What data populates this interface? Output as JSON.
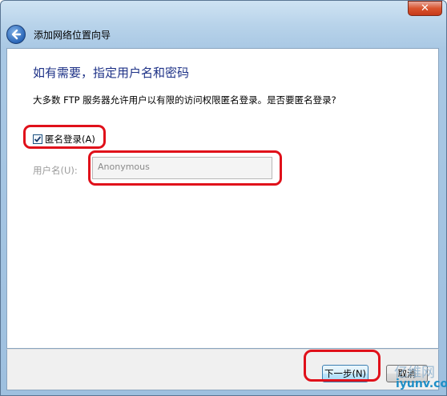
{
  "window": {
    "title": "添加网络位置向导",
    "close_glyph": "✕"
  },
  "page": {
    "heading": "如有需要，指定用户名和密码",
    "question": "大多数 FTP 服务器允许用户以有限的访问权限匿名登录。是否要匿名登录?",
    "anonymous_checkbox": {
      "label": "匿名登录(A)",
      "checked": true
    },
    "username": {
      "label": "用户名(U):",
      "value": "Anonymous"
    }
  },
  "footer": {
    "next_label": "下一步(N)",
    "cancel_label": "取消"
  },
  "watermark": {
    "text_cn": "亿维网",
    "url": "iyunv.com"
  },
  "colors": {
    "heading": "#1e3287",
    "highlight": "#e0101a",
    "disabled_text": "#9a9a9a"
  },
  "icons": {
    "back": "back-arrow-icon",
    "close": "close-icon",
    "check": "checkmark-icon"
  }
}
